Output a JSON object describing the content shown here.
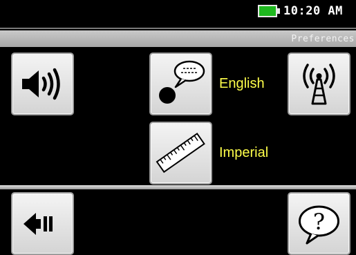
{
  "status": {
    "time": "10:20 AM",
    "battery_color": "#1fb81f",
    "battery_state": "full"
  },
  "header": {
    "title": "Preferences"
  },
  "preferences": {
    "volume_icon": "speaker-volume-icon",
    "language": {
      "icon": "speech-bubble-icon",
      "value": "English"
    },
    "wireless_icon": "wireless-tower-icon",
    "units": {
      "icon": "ruler-icon",
      "value": "Imperial"
    }
  },
  "footer": {
    "back_icon": "back-arrow-icon",
    "help_icon": "help-question-icon"
  },
  "colors": {
    "label_text": "#ffff4a",
    "background": "#000000"
  }
}
